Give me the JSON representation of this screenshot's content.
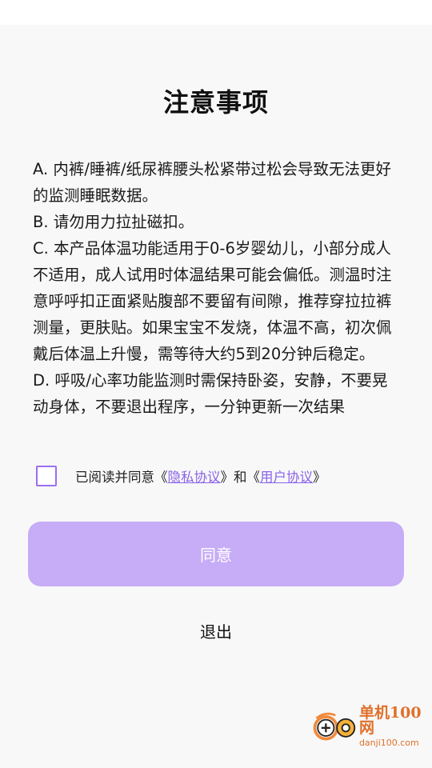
{
  "page": {
    "title": "注意事项"
  },
  "notice": {
    "items": [
      "A. 内裤/睡裤/纸尿裤腰头松紧带过松会导致无法更好的监测睡眠数据。",
      "B. 请勿用力拉扯磁扣。",
      "C. 本产品体温功能适用于0-6岁婴幼儿，小部分成人不适用，成人试用时体温结果可能会偏低。测温时注意呼呼扣正面紧贴腹部不要留有间隙，推荐穿拉拉裤测量，更肤贴。如果宝宝不发烧，体温不高，初次佩戴后体温上升慢，需等待大约5到20分钟后稳定。",
      "D. 呼吸/心率功能监测时需保持卧姿，安静，不要晃动身体，不要退出程序，一分钟更新一次结果"
    ]
  },
  "agreement": {
    "prefix": "已阅读并同意《",
    "privacy_link": "隐私协议",
    "middle": "》和《",
    "user_link": "用户协议",
    "suffix": "》"
  },
  "buttons": {
    "agree_label": "同意",
    "exit_label": "退出"
  },
  "watermark": {
    "name": "单机100网",
    "domain": "danji100.com"
  },
  "colors": {
    "accent": "#9a6ff0",
    "agree_button_bg": "#c7acf7",
    "link": "#8a63e8",
    "watermark": "#e0712b"
  }
}
